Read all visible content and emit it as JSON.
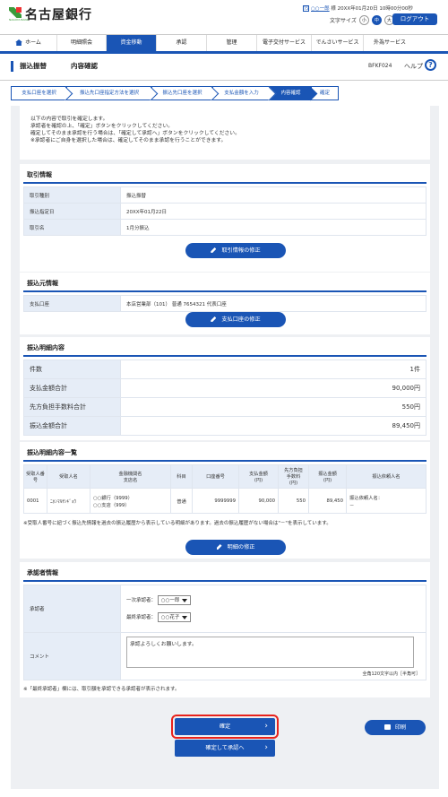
{
  "header": {
    "bank_name": "名古屋銀行",
    "logo_sub": "NAGOYA BANK",
    "user_icon_text": "75",
    "user_name": "○○一郎",
    "user_suffix": " 様 ",
    "last_login": "20XX年01月20日 10時00分00秒",
    "font_size_label": "文字サイズ",
    "font_sizes": [
      "小",
      "中",
      "大"
    ],
    "logout_label": "ログアウト"
  },
  "nav": [
    "ホーム",
    "明細照会",
    "資金移動",
    "承認",
    "管理",
    "電子交付サービス",
    "でんさいサービス",
    "外為サービス"
  ],
  "page": {
    "title": "振込振替",
    "subtitle": "内容確認",
    "code": "BFKF024",
    "help": "ヘルプ",
    "help_icon": "?"
  },
  "steps": [
    "支払口座を選択",
    "振込先口座指定方法を選択",
    "振込先口座を選択",
    "支払金額を入力",
    "内容確認",
    "確定"
  ],
  "intro": [
    "以下の内容で取引を確定します。",
    "承認者を確認の上、「確定」ボタンをクリックしてください。",
    "確定してそのまま承認を行う場合は、「確定して承認へ」ボタンをクリックしてください。",
    "※承認者にご自身を選択した場合は、確定してそのまま承認を行うことができます。"
  ],
  "transaction": {
    "heading": "取引情報",
    "rows": [
      [
        "取引種別",
        "振込振替"
      ],
      [
        "振込指定日",
        "20XX年01月22日"
      ],
      [
        "取引名",
        "1月分振込"
      ]
    ],
    "edit_button": "取引情報の修正"
  },
  "source": {
    "heading": "振込元情報",
    "rows": [
      [
        "支払口座",
        "本店営業部（101） 普通 7654321 代表口座"
      ]
    ],
    "edit_button": "支払口座の修正"
  },
  "detail": {
    "heading": "振込明細内容",
    "rows": [
      [
        "件数",
        "1件"
      ],
      [
        "支払金額合計",
        "90,000円"
      ],
      [
        "先方負担手数料合計",
        "550円"
      ],
      [
        "振込金額合計",
        "89,450円"
      ]
    ]
  },
  "list": {
    "heading": "振込明細内容一覧",
    "headers": [
      "受取人番号",
      "受取人名",
      "金融機関名\n支店名",
      "科目",
      "口座番号",
      "支払金額\n(円)",
      "先方負担\n手数料\n(円)",
      "振込金額\n(円)",
      "振込依頼人名"
    ],
    "rows": [
      [
        "0001",
        "ﾆﾎﾝﾏﾙｻﾝｷﾞｮｳ",
        "○○銀行（9999）\n○○支店（999）",
        "普通",
        "9999999",
        "90,000",
        "550",
        "89,450",
        "振込依頼人名：\n－"
      ]
    ],
    "note": "※受取人番号に紐づく振込先情報を過去の振込履歴から表示している明細があります。過去の振込履歴がない場合は\"－\"を表示しています。",
    "edit_button": "明細の修正"
  },
  "approver": {
    "heading": "承認者情報",
    "label": "承認者",
    "first_label": "一次承認者：",
    "first_value": "○○一郎",
    "final_label": "最終承認者：",
    "final_value": "○○花子",
    "comment_label": "コメント",
    "comment_value": "承認よろしくお願いします。",
    "comment_limit": "全角120文字以内［半角可］",
    "note": "※「最終承認者」欄には、取引額を承認できる承認者が表示されます。"
  },
  "actions": {
    "confirm": "確定",
    "confirm_approve": "確定して承認へ",
    "print": "印刷"
  },
  "colors": {
    "primary": "#1a55b5",
    "highlight": "#e8221c"
  }
}
